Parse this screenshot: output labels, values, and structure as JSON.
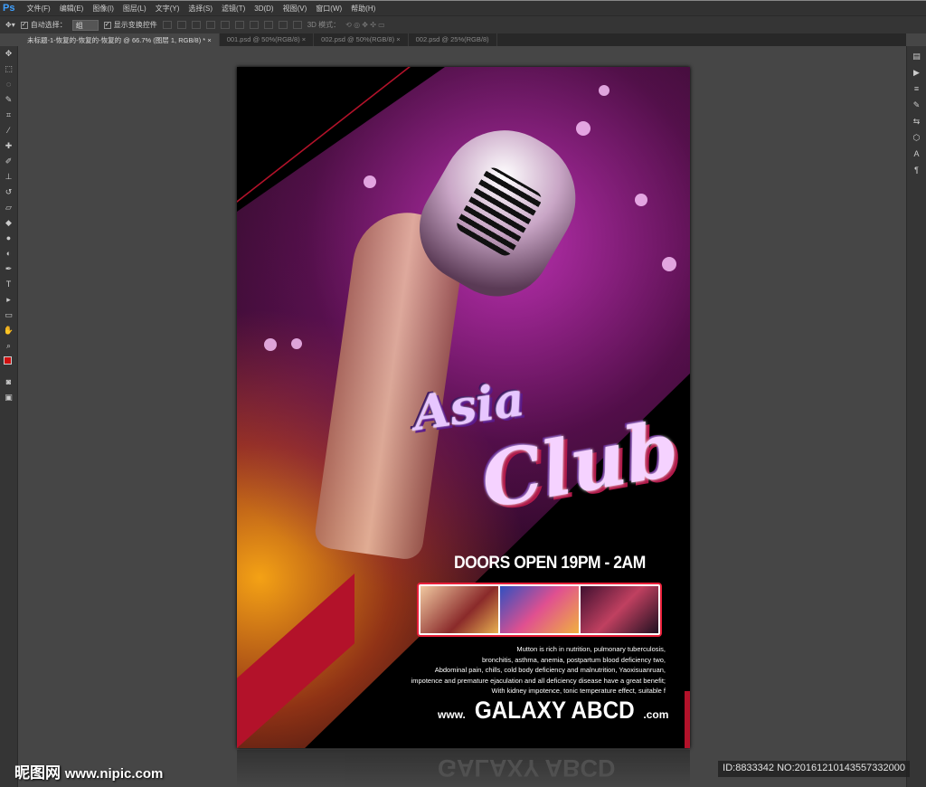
{
  "app": {
    "logo": "Ps"
  },
  "menu": [
    "文件(F)",
    "编辑(E)",
    "图像(I)",
    "图层(L)",
    "文字(Y)",
    "选择(S)",
    "滤镜(T)",
    "3D(D)",
    "视图(V)",
    "窗口(W)",
    "帮助(H)"
  ],
  "options": {
    "auto_select_label": "自动选择：",
    "auto_select_value": "组",
    "show_transform_label": "显示变换控件",
    "mode_3d_label": "3D 模式："
  },
  "tabs": [
    {
      "label": "未标题-1-恢复的-恢复的-恢复的 @ 66.7% (图层 1, RGB/8) *",
      "active": true
    },
    {
      "label": "001.psd @ 50%(RGB/8)",
      "active": false
    },
    {
      "label": "002.psd @ 50%(RGB/8)",
      "active": false
    },
    {
      "label": "002.psd @ 25%(RGB/8)",
      "active": false
    }
  ],
  "tab_close": "×",
  "poster": {
    "title_line1": "Asia",
    "title_line2": "Club",
    "doors": "DOORS OPEN 19PM - 2AM",
    "body_lines": [
      "Mutton is rich in nutrition, pulmonary tuberculosis,",
      "bronchitis, asthma, anemia, postpartum blood deficiency two,",
      "Abdominal pain, chills, cold body deficiency and malnutrition, Yaoxisuanruan,",
      "impotence and premature ejaculation and all deficiency disease have a great benefit;",
      "With kidney impotence, tonic temperature effect, suitable f"
    ],
    "url_prefix": "www.",
    "url_main": "GALAXY ABCD",
    "url_suffix": ".com",
    "accent": "#b3122a"
  },
  "watermark": {
    "brand": "昵图网",
    "url": "www.nipic.com",
    "id": "ID:8833342 NO:20161210143557332000"
  }
}
